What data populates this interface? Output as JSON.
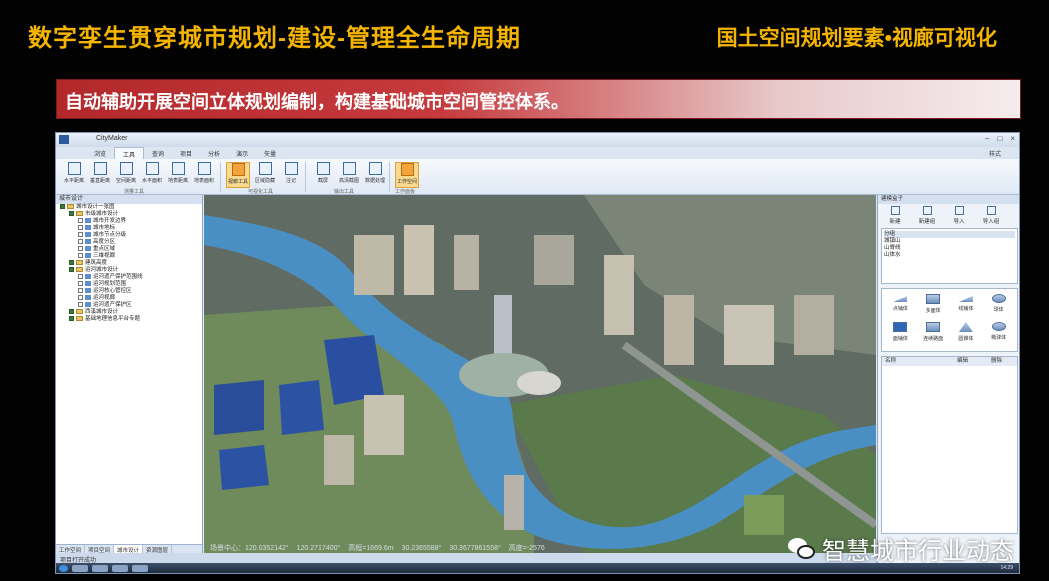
{
  "slide": {
    "title": "数字孪生贯穿城市规划-建设-管理全生命周期",
    "subtitle": "国土空间规划要素•视廊可视化",
    "banner": "自动辅助开展空间立体规划编制，构建基础城市空间管控体系。"
  },
  "app": {
    "name": "CityMaker",
    "window_buttons": [
      "–",
      "□",
      "×"
    ],
    "tabs": [
      "浏览",
      "工具",
      "查询",
      "项目",
      "分析",
      "演示",
      "矢量"
    ],
    "active_tab": "工具",
    "style_label": "样式",
    "ribbon_groups": [
      {
        "label": "测量工具",
        "buttons": [
          "水平距离",
          "垂直距离",
          "空间距离",
          "水平面积",
          "地表距离",
          "地表面积"
        ]
      },
      {
        "label": "可视化工具",
        "buttons": [
          "视廊工具",
          "区域隐藏",
          "注记"
        ]
      },
      {
        "label": "输出工具",
        "buttons": [
          "截屏",
          "高清截图",
          "数据处理"
        ]
      },
      {
        "label": "工作面板",
        "buttons": [
          "工作空间"
        ]
      }
    ],
    "left_panel": {
      "title": "城市设计",
      "tree": [
        {
          "label": "城市设计一张图",
          "level": 0,
          "checked": true,
          "type": "folder"
        },
        {
          "label": "市级城市设计",
          "level": 1,
          "checked": true,
          "type": "folder"
        },
        {
          "label": "城市开发边界",
          "level": 2,
          "checked": false,
          "type": "layer"
        },
        {
          "label": "城市地标",
          "level": 2,
          "checked": false,
          "type": "layer"
        },
        {
          "label": "城市节点分级",
          "level": 2,
          "checked": false,
          "type": "layer"
        },
        {
          "label": "高度分区",
          "level": 2,
          "checked": false,
          "type": "layer"
        },
        {
          "label": "重点区域",
          "level": 2,
          "checked": false,
          "type": "layer"
        },
        {
          "label": "三维视廊",
          "level": 2,
          "checked": false,
          "type": "layer"
        },
        {
          "label": "建筑高度",
          "level": 1,
          "checked": true,
          "type": "folder"
        },
        {
          "label": "运河城市设计",
          "level": 1,
          "checked": true,
          "type": "folder"
        },
        {
          "label": "运河遗产保护范围线",
          "level": 2,
          "checked": false,
          "type": "layer"
        },
        {
          "label": "运河规划范围",
          "level": 2,
          "checked": false,
          "type": "layer"
        },
        {
          "label": "运河核心管控区",
          "level": 2,
          "checked": false,
          "type": "layer"
        },
        {
          "label": "运河视廊",
          "level": 2,
          "checked": false,
          "type": "layer"
        },
        {
          "label": "运河遗产保护区",
          "level": 2,
          "checked": false,
          "type": "layer"
        },
        {
          "label": "西溪城市设计",
          "level": 1,
          "checked": true,
          "type": "folder"
        },
        {
          "label": "基础地理信息平台专题",
          "level": 1,
          "checked": true,
          "type": "folder"
        }
      ],
      "tabs": [
        "工作空间",
        "项目空间",
        "城市设计",
        "资源图层"
      ],
      "active_tab": "城市设计"
    },
    "right_panel": {
      "title": "建模盒子",
      "toolbar": [
        "新建",
        "新建组",
        "导入",
        "导入组"
      ],
      "group_header": "分组",
      "groups": [
        "城镇山",
        "山脊线",
        "山体水"
      ],
      "shapes": [
        {
          "label": "点铺体",
          "form": "flat"
        },
        {
          "label": "多面体",
          "form": "box"
        },
        {
          "label": "线铺体",
          "form": "flat"
        },
        {
          "label": "球体",
          "form": "round"
        },
        {
          "label": "面铺体",
          "form": "box",
          "selected": true
        },
        {
          "label": "连续路面",
          "form": "box"
        },
        {
          "label": "圆锥体",
          "form": "tri"
        },
        {
          "label": "椭球体",
          "form": "round"
        }
      ],
      "columns": [
        "名称",
        "编辑",
        "删除"
      ]
    },
    "map_status": {
      "center": "场景中心：120.0352142°",
      "lon": "120.2717400°",
      "height": "高程=1669.6m",
      "lat": "30.2365588°",
      "alt": "30.3677861558°",
      "zoom": "高度=-2576"
    },
    "status_text": "项目打开成功",
    "clock": "14:29"
  },
  "watermark": "智慧城市行业动态"
}
